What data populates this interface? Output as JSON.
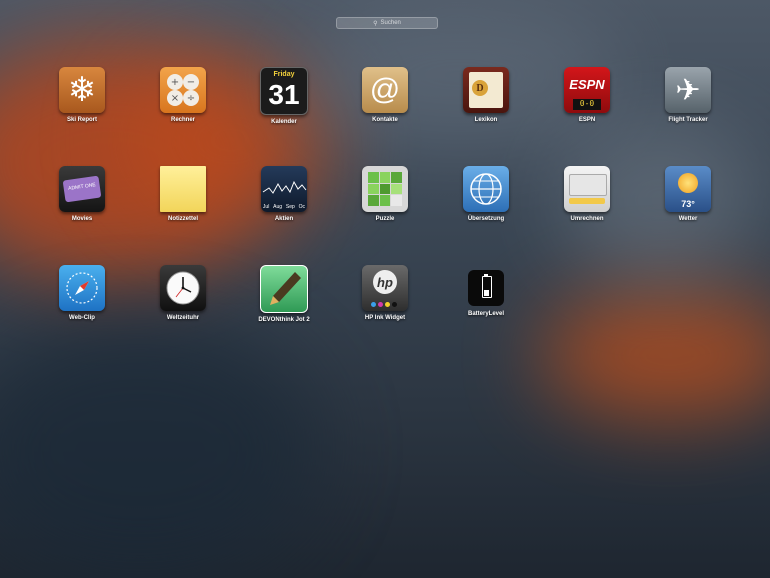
{
  "search": {
    "placeholder": "Suchen"
  },
  "apps": [
    {
      "label": "Ski Report",
      "icon": "snowflake-icon"
    },
    {
      "label": "Rechner",
      "icon": "calculator-icon"
    },
    {
      "label": "Kalender",
      "icon": "calendar-icon",
      "day_name": "Friday",
      "day_number": "31"
    },
    {
      "label": "Kontakte",
      "icon": "at-sign-icon"
    },
    {
      "label": "Lexikon",
      "icon": "dictionary-icon"
    },
    {
      "label": "ESPN",
      "icon": "espn-icon",
      "brand": "ESPN",
      "score": "0-0"
    },
    {
      "label": "Flight Tracker",
      "icon": "airplane-icon"
    },
    {
      "label": "Movies",
      "icon": "ticket-icon",
      "ticket_text": "ADMIT ONE"
    },
    {
      "label": "Notizzettel",
      "icon": "sticky-note-icon"
    },
    {
      "label": "Aktien",
      "icon": "stock-chart-icon",
      "months": [
        "Jul",
        "Aug",
        "Sep",
        "Oc"
      ]
    },
    {
      "label": "Puzzle",
      "icon": "puzzle-icon"
    },
    {
      "label": "Übersetzung",
      "icon": "globe-icon"
    },
    {
      "label": "Umrechnen",
      "icon": "keyboard-icon"
    },
    {
      "label": "Wetter",
      "icon": "weather-sun-icon",
      "temperature": "73°"
    },
    {
      "label": "Web-Clip",
      "icon": "compass-icon"
    },
    {
      "label": "Weltzeituhr",
      "icon": "clock-icon"
    },
    {
      "label": "DEVONthink Jot 2",
      "icon": "pen-icon"
    },
    {
      "label": "HP Ink Widget",
      "icon": "hp-logo-icon"
    },
    {
      "label": "BatteryLevel",
      "icon": "battery-icon"
    }
  ]
}
